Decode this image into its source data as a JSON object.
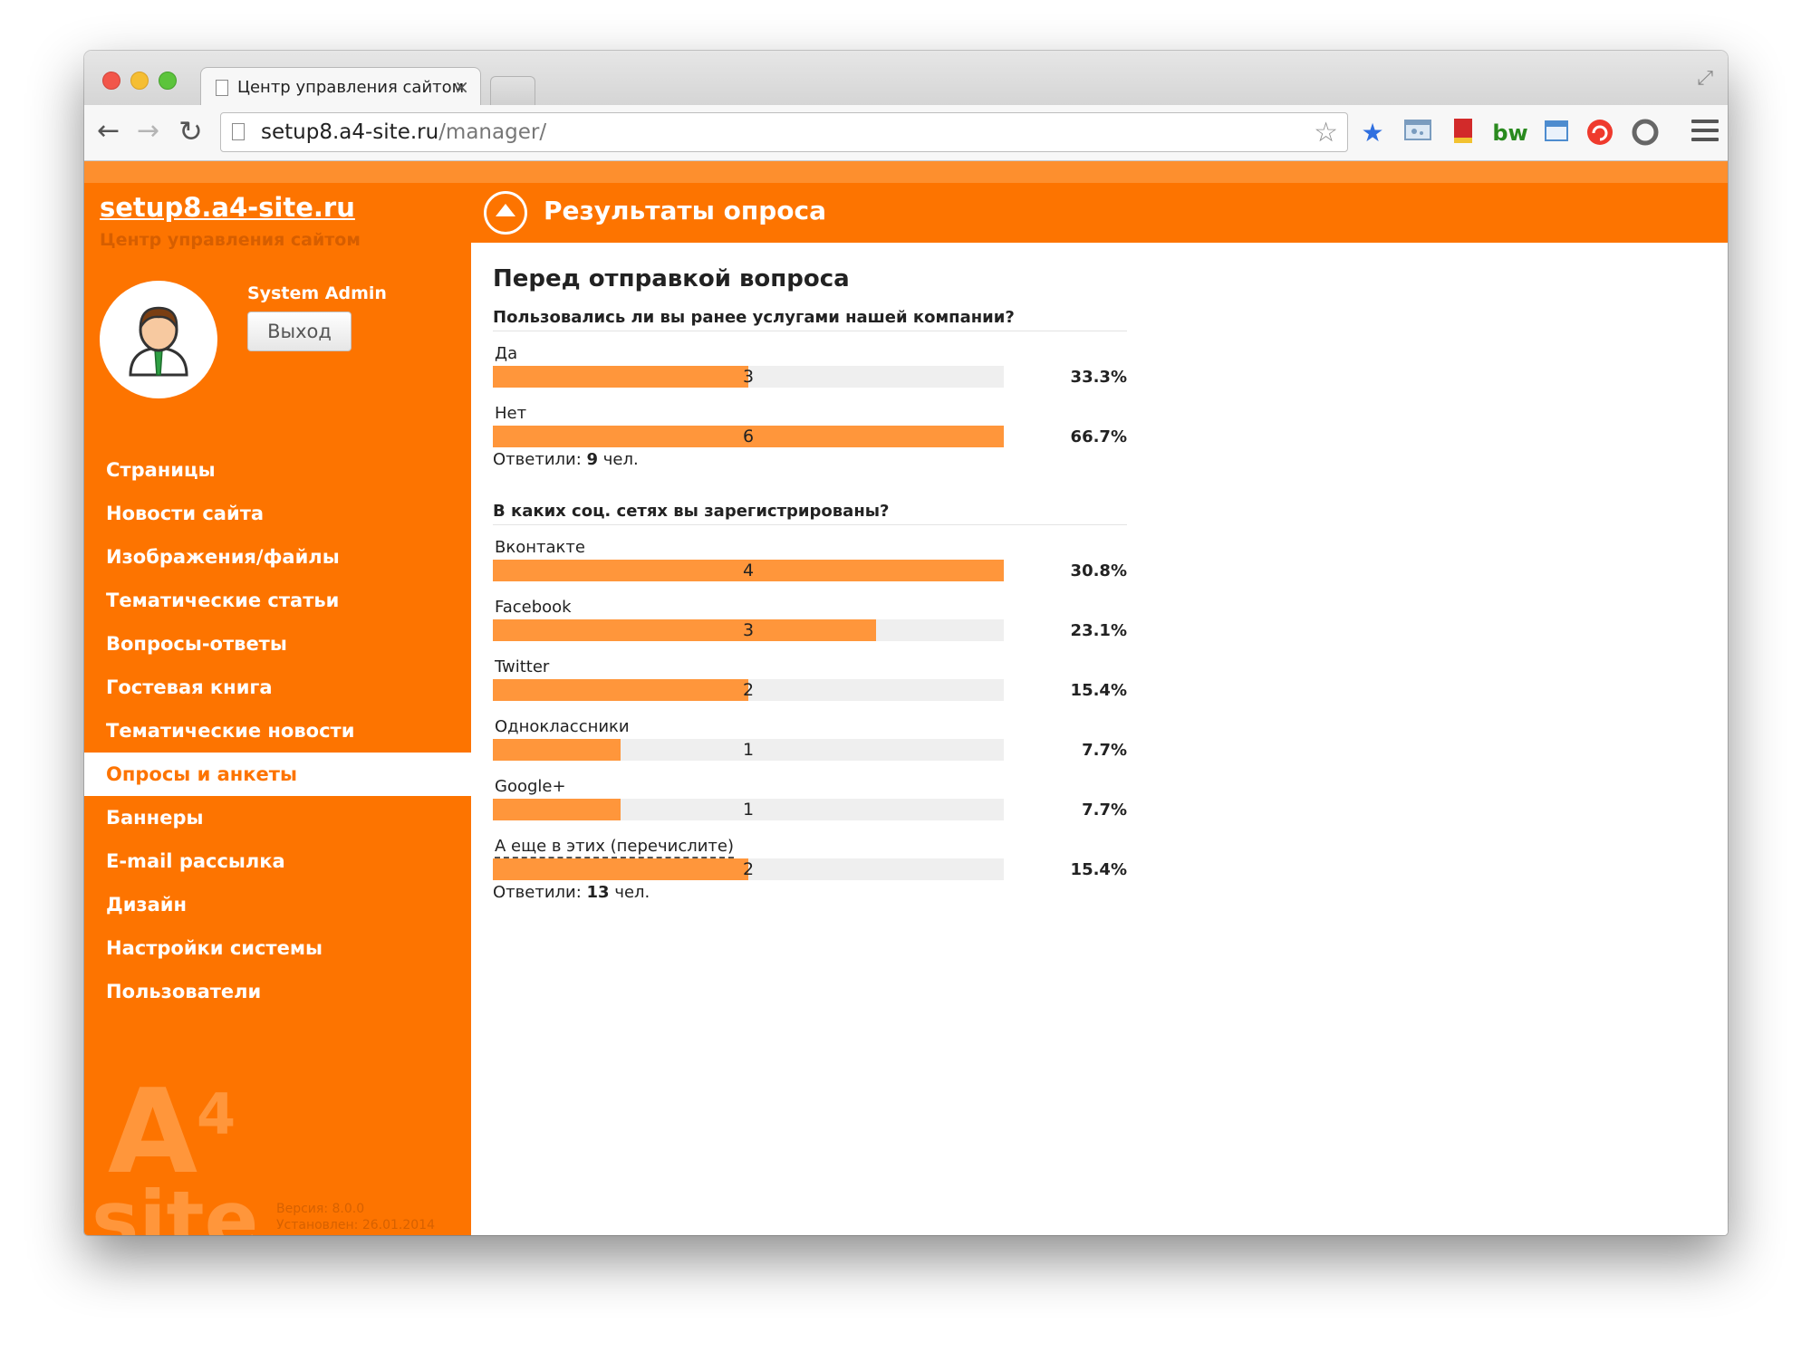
{
  "browser": {
    "tab_title": "Центр управления сайтом",
    "tab_close": "×",
    "url_host": "setup8.a4-site.ru",
    "url_path": "/manager/",
    "extensions": [
      "star-bookmark-icon",
      "screenshot-icon",
      "book-icon",
      "bw-icon",
      "calendar-icon",
      "refresh-red-icon",
      "circle-icon"
    ]
  },
  "sidebar": {
    "site_link": "setup8.a4-site.ru",
    "site_subtitle": "Центр управления сайтом",
    "user_name": "System Admin",
    "logout_label": "Выход",
    "nav": [
      {
        "label": "Страницы",
        "active": false
      },
      {
        "label": "Новости сайта",
        "active": false
      },
      {
        "label": "Изображения/файлы",
        "active": false
      },
      {
        "label": "Тематические статьи",
        "active": false
      },
      {
        "label": "Вопросы-ответы",
        "active": false
      },
      {
        "label": "Гостевая книга",
        "active": false
      },
      {
        "label": "Тематические новости",
        "active": false
      },
      {
        "label": "Опросы и анкеты",
        "active": true
      },
      {
        "label": "Баннеры",
        "active": false
      },
      {
        "label": "E-mail рассылка",
        "active": false
      },
      {
        "label": "Дизайн",
        "active": false
      },
      {
        "label": "Настройки системы",
        "active": false
      },
      {
        "label": "Пользователи",
        "active": false
      }
    ],
    "logo_a": "A",
    "logo_4": "4",
    "logo_site": "site",
    "version": "Версия: 8.0.0",
    "installed": "Установлен: 26.01.2014"
  },
  "main": {
    "title": "Результаты опроса",
    "poll_title": "Перед отправкой вопроса",
    "questions": [
      {
        "text": "Пользовались ли вы ранее услугами нашей компании?",
        "answers": [
          {
            "label": "Да",
            "count": "3",
            "percent": "33.3%",
            "fraction": 0.5
          },
          {
            "label": "Нет",
            "count": "6",
            "percent": "66.7%",
            "fraction": 1.0
          }
        ],
        "respondents_label": "Ответили:",
        "respondents_count": "9",
        "respondents_unit": "чел."
      },
      {
        "text": "В каких соц. сетях вы зарегистрированы?",
        "answers": [
          {
            "label": "Вконтакте",
            "count": "4",
            "percent": "30.8%",
            "fraction": 1.0
          },
          {
            "label": "Facebook",
            "count": "3",
            "percent": "23.1%",
            "fraction": 0.75
          },
          {
            "label": "Twitter",
            "count": "2",
            "percent": "15.4%",
            "fraction": 0.5
          },
          {
            "label": "Одноклассники",
            "count": "1",
            "percent": "7.7%",
            "fraction": 0.25
          },
          {
            "label": "Google+",
            "count": "1",
            "percent": "7.7%",
            "fraction": 0.25
          },
          {
            "label": "А еще в этих (перечислите)",
            "count": "2",
            "percent": "15.4%",
            "fraction": 0.5,
            "dashed": true
          }
        ],
        "respondents_label": "Ответили:",
        "respondents_count": "13",
        "respondents_unit": "чел."
      }
    ]
  }
}
